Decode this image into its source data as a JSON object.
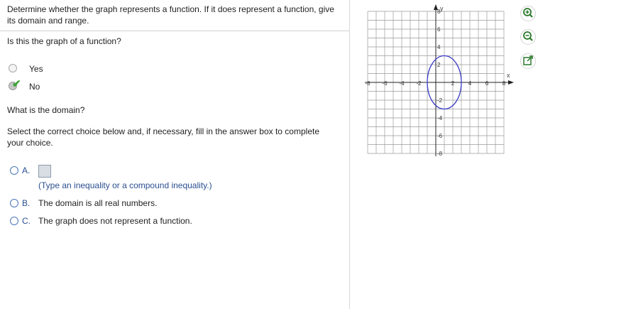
{
  "question": {
    "prompt": "Determine whether the graph represents a function. If it does represent a function, give its domain and range.",
    "q1": "Is this the graph of a function?",
    "q1_options": [
      "Yes",
      "No"
    ],
    "q1_selected": "No",
    "q2": "What is the domain?",
    "instructions": "Select the correct choice below and, if necessary, fill in the answer box to complete your choice.",
    "choices": [
      {
        "letter": "A.",
        "text": "",
        "hint": "(Type an inequality or a compound inequality.)"
      },
      {
        "letter": "B.",
        "text": "The domain is all real numbers."
      },
      {
        "letter": "C.",
        "text": "The graph does not represent a function."
      }
    ]
  },
  "graph": {
    "x_label": "x",
    "y_label": "y",
    "x_ticks": [
      "-8",
      "-6",
      "-4",
      "-2",
      "2",
      "4",
      "6",
      "8"
    ],
    "y_ticks": [
      "8",
      "6",
      "4",
      "2",
      "-2",
      "-4",
      "-6",
      "-8"
    ],
    "range": [
      -8,
      8
    ],
    "grid": true,
    "curve": {
      "type": "ellipse",
      "center": [
        1,
        0
      ],
      "rx": 2,
      "ry": 3,
      "color": "#3a3ac8"
    }
  },
  "tools": [
    "zoom-in-icon",
    "zoom-out-icon",
    "popout-icon"
  ]
}
